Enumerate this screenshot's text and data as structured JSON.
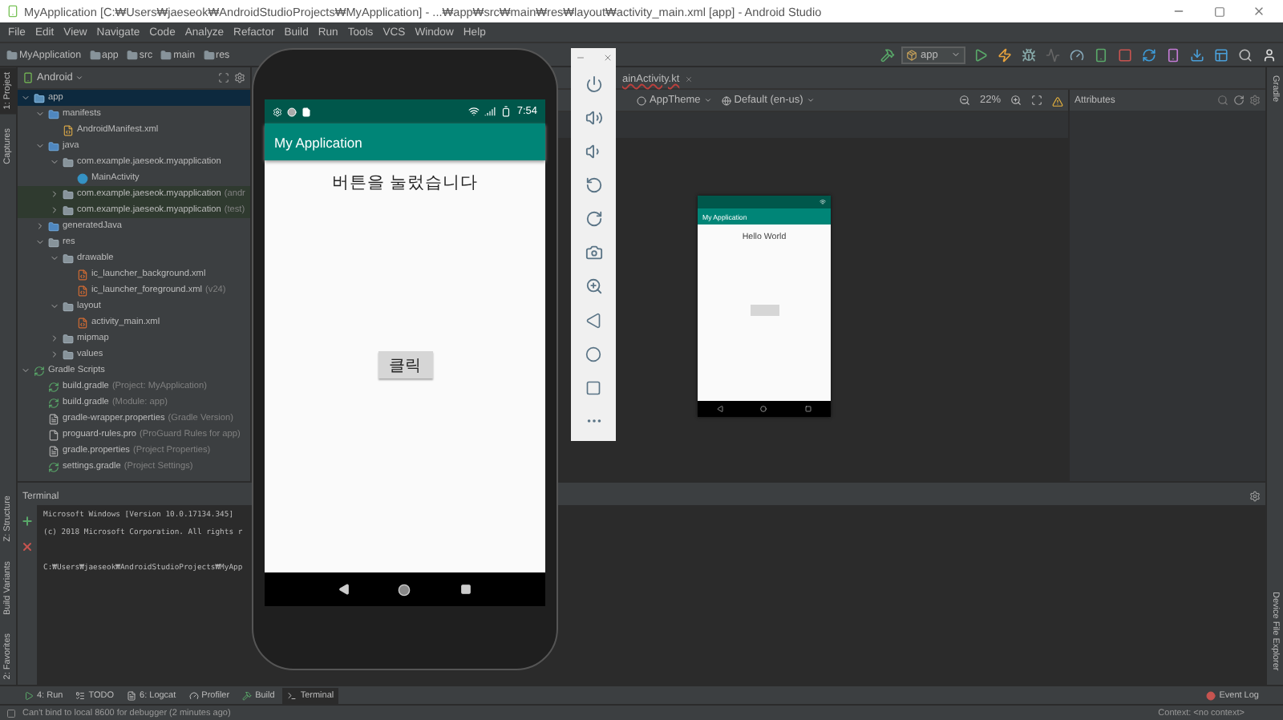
{
  "window": {
    "title": "MyApplication [C:₩Users₩jaeseok₩AndroidStudioProjects₩MyApplication] - ...₩app₩src₩main₩res₩layout₩activity_main.xml [app] - Android Studio"
  },
  "menu": [
    "File",
    "Edit",
    "View",
    "Navigate",
    "Code",
    "Analyze",
    "Refactor",
    "Build",
    "Run",
    "Tools",
    "VCS",
    "Window",
    "Help"
  ],
  "breadcrumbs": [
    "MyApplication",
    "app",
    "src",
    "main",
    "res"
  ],
  "run_config": "app",
  "left_stripe_top": [
    {
      "label": "1: Project",
      "selected": true
    },
    {
      "label": "Captures",
      "selected": false
    }
  ],
  "left_stripe_bottom": [
    {
      "label": "Z: Structure",
      "selected": false
    },
    {
      "label": "Build Variants",
      "selected": false
    },
    {
      "label": "2: Favorites",
      "selected": false
    }
  ],
  "right_stripe_top": [
    "Gradle"
  ],
  "right_stripe_bottom": [
    "Device File Explorer"
  ],
  "project": {
    "view": "Android",
    "tree": [
      {
        "label": "app",
        "kind": "module",
        "selected": true,
        "expanded": true,
        "children": [
          {
            "label": "manifests",
            "kind": "folder",
            "selected": false,
            "expanded": true,
            "children": [
              {
                "label": "AndroidManifest.xml",
                "kind": "manifest",
                "selected": false
              }
            ]
          },
          {
            "label": "java",
            "kind": "folder",
            "selected": false,
            "expanded": true,
            "children": [
              {
                "label": "com.example.jaeseok.myapplication",
                "kind": "package",
                "selected": false,
                "expanded": true,
                "children": [
                  {
                    "label": "MainActivity",
                    "kind": "class",
                    "selected": false
                  }
                ]
              },
              {
                "label": "com.example.jaeseok.myapplication",
                "note": "(andr",
                "kind": "test_package",
                "selected": false,
                "expanded": false
              },
              {
                "label": "com.example.jaeseok.myapplication",
                "note": "(test)",
                "kind": "test_package",
                "selected": false,
                "expanded": false
              }
            ]
          },
          {
            "label": "generatedJava",
            "kind": "folder",
            "selected": false,
            "expanded": false
          },
          {
            "label": "res",
            "kind": "package",
            "selected": false,
            "expanded": true,
            "children": [
              {
                "label": "drawable",
                "kind": "package",
                "selected": false,
                "expanded": true,
                "children": [
                  {
                    "label": "ic_launcher_background.xml",
                    "kind": "xml",
                    "selected": false
                  },
                  {
                    "label": "ic_launcher_foreground.xml",
                    "note": "(v24)",
                    "kind": "xml",
                    "selected": false
                  }
                ]
              },
              {
                "label": "layout",
                "kind": "package",
                "selected": false,
                "expanded": true,
                "children": [
                  {
                    "label": "activity_main.xml",
                    "kind": "xml",
                    "selected": false
                  }
                ]
              },
              {
                "label": "mipmap",
                "kind": "package",
                "selected": false,
                "expanded": false
              },
              {
                "label": "values",
                "kind": "package",
                "selected": false,
                "expanded": false
              }
            ]
          }
        ]
      },
      {
        "label": "Gradle Scripts",
        "kind": "gradle",
        "selected": false,
        "expanded": true,
        "children": [
          {
            "label": "build.gradle",
            "note": "(Project: MyApplication)",
            "kind": "gradle",
            "selected": false
          },
          {
            "label": "build.gradle",
            "note": "(Module: app)",
            "kind": "gradle",
            "selected": false
          },
          {
            "label": "gradle-wrapper.properties",
            "note": "(Gradle Version)",
            "kind": "properties",
            "selected": false
          },
          {
            "label": "proguard-rules.pro",
            "note": "(ProGuard Rules for app)",
            "kind": "text",
            "selected": false
          },
          {
            "label": "gradle.properties",
            "note": "(Project Properties)",
            "kind": "properties",
            "selected": false
          },
          {
            "label": "settings.gradle",
            "note": "(Project Settings)",
            "kind": "gradle",
            "selected": false
          }
        ]
      }
    ]
  },
  "editor_tab": "ainActivity.kt",
  "design_toolbar": {
    "theme": "AppTheme",
    "locale": "Default (en-us)",
    "zoom": "22%"
  },
  "preview": {
    "app_title": "My Application",
    "text": "Hello World"
  },
  "attributes": {
    "title": "Attributes"
  },
  "terminal": {
    "title": "Terminal",
    "lines": [
      "Microsoft Windows [Version 10.0.17134.345]",
      "(c) 2018 Microsoft Corporation. All rights r",
      "C:₩Users₩jaeseok₩AndroidStudioProjects₩MyApp"
    ]
  },
  "tool_tabs": [
    {
      "label": "4: Run",
      "kind": "run",
      "selected": false
    },
    {
      "label": "TODO",
      "kind": "todo",
      "selected": false
    },
    {
      "label": "6: Logcat",
      "kind": "logcat",
      "selected": false
    },
    {
      "label": "Profiler",
      "kind": "profiler",
      "selected": false
    },
    {
      "label": "Build",
      "kind": "build",
      "selected": false
    },
    {
      "label": "Terminal",
      "kind": "terminal",
      "selected": true
    }
  ],
  "event_log": "Event Log",
  "status": {
    "message": "Can't bind to local 8600 for debugger (2 minutes ago)",
    "context": "Context: <no context>"
  },
  "emulator": {
    "time": "7:54",
    "app_title": "My Application",
    "message": "버튼을 눌렀습니다",
    "button": "클릭"
  }
}
